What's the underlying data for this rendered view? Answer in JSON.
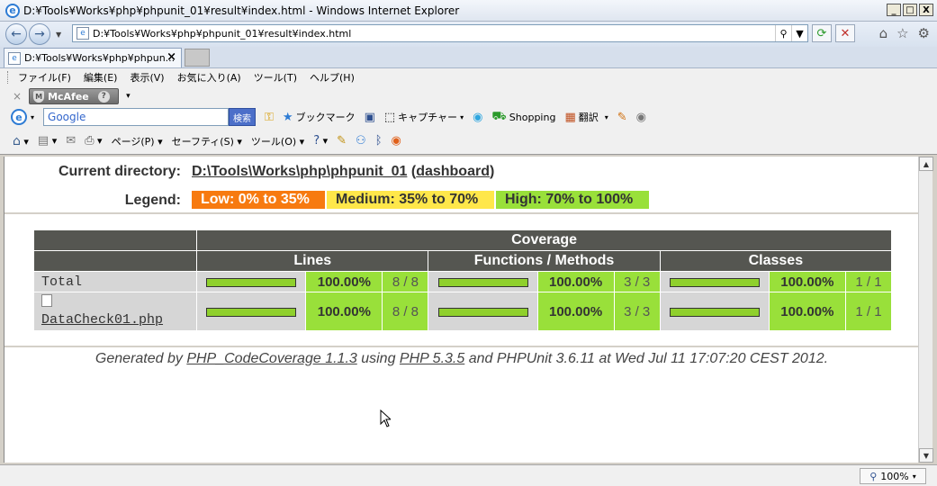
{
  "window": {
    "title": "D:¥Tools¥Works¥php¥phpunit_01¥result¥index.html - Windows Internet Explorer",
    "minimize": "_",
    "maximize": "□",
    "close": "X"
  },
  "nav": {
    "back_icon": "←",
    "forward_icon": "→",
    "address": "D:¥Tools¥Works¥php¥phpunit_01¥result¥index.html",
    "search_icon": "⚲",
    "refresh_icon": "⟳",
    "stop_icon": "✕",
    "home_icon": "⌂",
    "favorites_icon": "☆",
    "tools_icon": "⚙"
  },
  "tab": {
    "label": "D:¥Tools¥Works¥php¥phpun...",
    "close": "×"
  },
  "menu": [
    "ファイル(F)",
    "編集(E)",
    "表示(V)",
    "お気に入り(A)",
    "ツール(T)",
    "ヘルプ(H)"
  ],
  "mcafee": {
    "close": "×",
    "label": "McAfee",
    "help": "?",
    "dropdown": "▾"
  },
  "google": {
    "logo": "e",
    "input": "Google",
    "search_button": "検索",
    "bookmark": "ブックマーク",
    "capture": "キャプチャー",
    "shopping": "Shopping",
    "translate": "翻訳"
  },
  "command": {
    "page": "ページ(P)",
    "safety": "セーフティ(S)",
    "tools": "ツール(O)"
  },
  "report": {
    "current_dir_label": "Current directory:",
    "current_dir_path": "D:\\Tools\\Works\\php\\phpunit_01",
    "dashboard_link": "dashboard",
    "legend_label": "Legend:",
    "legend_low": "Low: 0% to 35%",
    "legend_medium": "Medium: 35% to 70%",
    "legend_high": "High: 70% to 100%",
    "colors": {
      "low": "#f77a10",
      "medium": "#ffe74a",
      "high": "#99e03a",
      "header": "#555651"
    },
    "table": {
      "group_header": "Coverage",
      "col_lines": "Lines",
      "col_functions": "Functions / Methods",
      "col_classes": "Classes",
      "rows": [
        {
          "name": "Total",
          "lines_pct": "100.00%",
          "lines_ratio": "8 / 8",
          "lines_fill": 1.0,
          "funcs_pct": "100.00%",
          "funcs_ratio": "3 / 3",
          "funcs_fill": 1.0,
          "classes_pct": "100.00%",
          "classes_ratio": "1 / 1",
          "classes_fill": 1.0
        },
        {
          "name": "DataCheck01.php",
          "lines_pct": "100.00%",
          "lines_ratio": "8 / 8",
          "lines_fill": 1.0,
          "funcs_pct": "100.00%",
          "funcs_ratio": "3 / 3",
          "funcs_fill": 1.0,
          "classes_pct": "100.00%",
          "classes_ratio": "1 / 1",
          "classes_fill": 1.0
        }
      ]
    },
    "footer": {
      "prefix": "Generated by ",
      "link1": "PHP_CodeCoverage 1.1.3",
      "mid": " using ",
      "link2": "PHP 5.3.5",
      "suffix": " and PHPUnit 3.6.11 at Wed Jul 11 17:07:20 CEST 2012."
    }
  },
  "status": {
    "zoom": "100%"
  }
}
